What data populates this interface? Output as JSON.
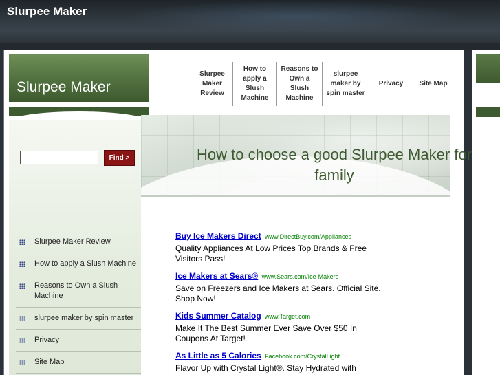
{
  "header": {
    "site_title": "Slurpee Maker"
  },
  "logo": {
    "text": "Slurpee Maker"
  },
  "search": {
    "value": "",
    "placeholder": "",
    "button_label": "Find >"
  },
  "top_nav": [
    {
      "label": "Slurpee Maker Review",
      "lines": [
        "Slurpee",
        "Maker",
        "Review"
      ]
    },
    {
      "label": "How to apply a Slush Machine",
      "lines": [
        "How to",
        "apply a",
        "Slush",
        "Machine"
      ]
    },
    {
      "label": "Reasons to Own a Slush Machine",
      "lines": [
        "Reasons to",
        "Own a",
        "Slush",
        "Machine"
      ]
    },
    {
      "label": "slurpee maker by spin master",
      "lines": [
        "slurpee",
        "maker by",
        "spin master"
      ]
    },
    {
      "label": "Privacy",
      "lines": [
        "Privacy"
      ]
    },
    {
      "label": "Site Map",
      "lines": [
        "Site Map"
      ]
    }
  ],
  "side_nav": [
    {
      "label": "Slurpee Maker Review"
    },
    {
      "label": "How to apply a Slush Machine"
    },
    {
      "label": "Reasons to Own a Slush Machine"
    },
    {
      "label": "slurpee maker by spin master"
    },
    {
      "label": "Privacy"
    },
    {
      "label": "Site Map"
    }
  ],
  "banner": {
    "title": "How to choose a good Slurpee Maker for family"
  },
  "ads": [
    {
      "title": "Buy Ice Makers Direct",
      "url": "www.DirectBuy.com/Appliances",
      "desc": "Quality Appliances At Low Prices Top Brands & Free Visitors Pass!"
    },
    {
      "title": "Ice Makers at Sears®",
      "url": "www.Sears.com/Ice-Makers",
      "desc": "Save on Freezers and Ice Makers at Sears. Official Site. Shop Now!"
    },
    {
      "title": "Kids Summer Catalog",
      "url": "www.Target.com",
      "desc": "Make It The Best Summer Ever Save Over $50 In Coupons At Target!"
    },
    {
      "title": "As Little as 5 Calories",
      "url": "Facebook.com/CrystalLight",
      "desc": "Flavor Up with Crystal Light®. Stay Hydrated with"
    }
  ],
  "colors": {
    "brand_green": "#3e5a30",
    "find_button": "#8b1414",
    "ad_link": "#0000cc",
    "ad_url": "#008000",
    "header_dark": "#2b3138"
  },
  "icons": {
    "side_nav_bullet": "grid-bullet-icon"
  }
}
